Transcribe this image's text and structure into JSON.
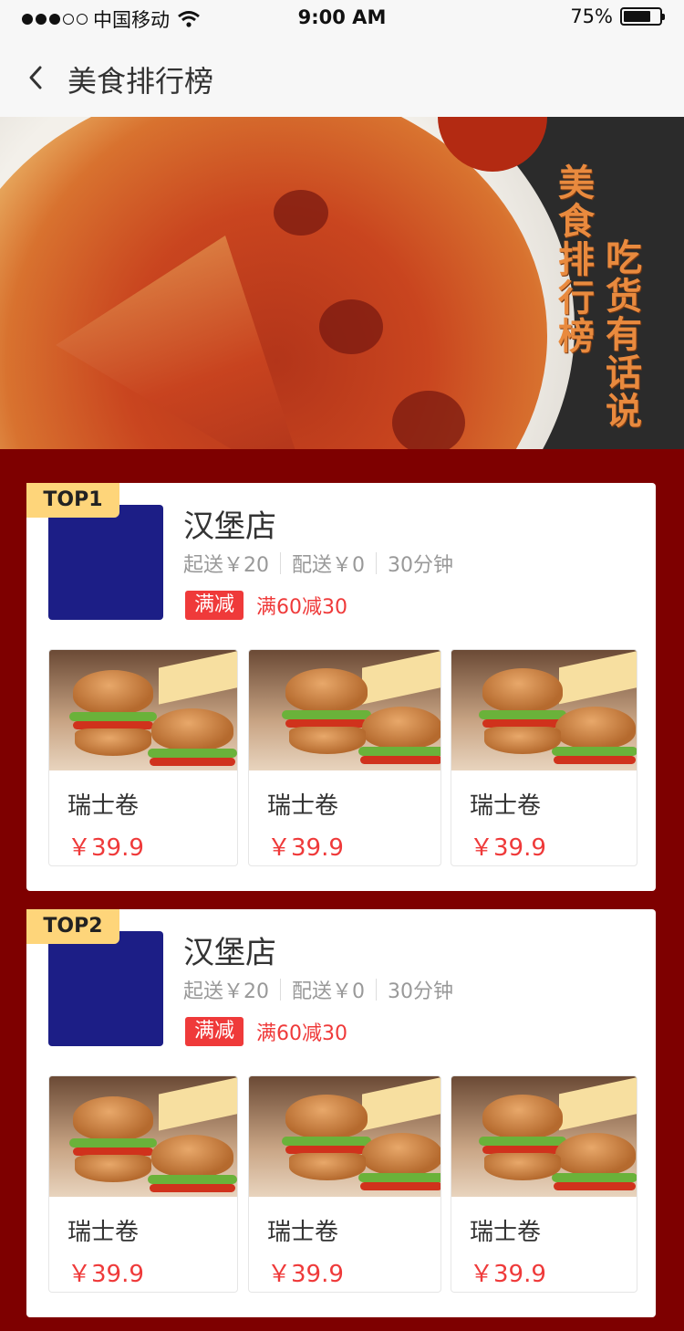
{
  "status_bar": {
    "carrier": "中国移动",
    "time": "9:00 AM",
    "battery": "75%",
    "battery_level": 0.75
  },
  "nav": {
    "title": "美食排行榜",
    "back_icon": "chevron-left-icon"
  },
  "banner": {
    "text_col1": "美食排行榜",
    "text_col2": "吃货有话说"
  },
  "shops": [
    {
      "rank": "TOP1",
      "name": "汉堡店",
      "min_order": "起送￥20",
      "delivery_fee": "配送￥0",
      "delivery_time": "30分钟",
      "promo_badge": "满减",
      "promo_text": "满60减30",
      "products": [
        {
          "name": "瑞士卷",
          "price": "￥39.9"
        },
        {
          "name": "瑞士卷",
          "price": "￥39.9"
        },
        {
          "name": "瑞士卷",
          "price": "￥39.9"
        }
      ]
    },
    {
      "rank": "TOP2",
      "name": "汉堡店",
      "min_order": "起送￥20",
      "delivery_fee": "配送￥0",
      "delivery_time": "30分钟",
      "promo_badge": "满减",
      "promo_text": "满60减30",
      "products": [
        {
          "name": "瑞士卷",
          "price": "￥39.9"
        },
        {
          "name": "瑞士卷",
          "price": "￥39.9"
        },
        {
          "name": "瑞士卷",
          "price": "￥39.9"
        }
      ]
    }
  ],
  "colors": {
    "page_bg": "#7e0000",
    "accent_red": "#ef3a3a",
    "rank_tag": "#fed57a",
    "shop_logo": "#1c1e86"
  }
}
